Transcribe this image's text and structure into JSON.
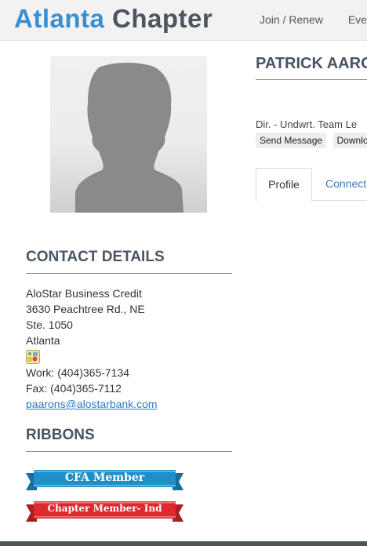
{
  "header": {
    "logo_part1": "Atlanta",
    "logo_part2": "Chapter",
    "nav": [
      "Join / Renew",
      "Even"
    ]
  },
  "profile": {
    "name": "PATRICK AARO",
    "title": "Dir. - Undwrt. Team Le",
    "actions": {
      "send_message": "Send Message",
      "download": "Downlo"
    },
    "tabs": {
      "profile": "Profile",
      "connect": "Connect"
    }
  },
  "contact": {
    "heading": "CONTACT DETAILS",
    "company": "AloStar Business Credit",
    "address1": "3630 Peachtree Rd., NE",
    "address2": "Ste. 1050",
    "city": "Atlanta",
    "work": "Work: (404)365-7134",
    "fax": "Fax: (404)365-7112",
    "email": "paarons@alostarbank.com"
  },
  "ribbons": {
    "heading": "RIBBONS",
    "items": [
      {
        "label": "CFA Member",
        "color": "#1e8fc8"
      },
      {
        "label": "Chapter Member- Ind",
        "color": "#e0282e"
      }
    ]
  },
  "colors": {
    "accent_blue": "#3b8fd0",
    "heading_gray": "#4a5563",
    "link": "#2f7ac1"
  }
}
